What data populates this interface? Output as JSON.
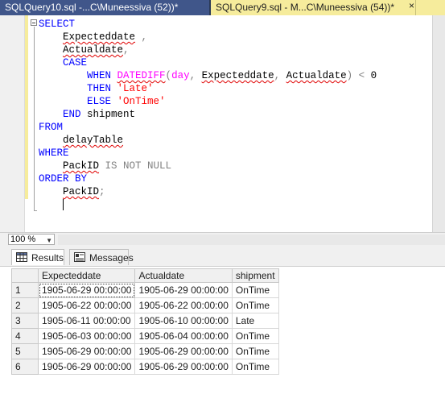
{
  "tabs": [
    {
      "label": "SQLQuery10.sql -...C\\Muneessiva (52))*",
      "active": false
    },
    {
      "label": "SQLQuery9.sql - M...C\\Muneessiva (54))*",
      "active": true,
      "close": "×"
    }
  ],
  "editor": {
    "lines": [
      {
        "tokens": [
          {
            "t": "SELECT",
            "c": "kw"
          }
        ]
      },
      {
        "tokens": [
          {
            "t": "    "
          },
          {
            "t": "Expecteddate",
            "c": "sq"
          },
          {
            "t": " ,",
            "c": "gr"
          }
        ]
      },
      {
        "tokens": [
          {
            "t": "    "
          },
          {
            "t": "Actualdate",
            "c": "sq"
          },
          {
            "t": ",",
            "c": "gr"
          }
        ]
      },
      {
        "tokens": [
          {
            "t": "    "
          },
          {
            "t": "CASE",
            "c": "kw"
          }
        ]
      },
      {
        "tokens": [
          {
            "t": "        "
          },
          {
            "t": "WHEN ",
            "c": "kw"
          },
          {
            "t": "DATEDIFF",
            "c": "fn sq"
          },
          {
            "t": "(",
            "c": "gr"
          },
          {
            "t": "day",
            "c": "fn"
          },
          {
            "t": ", ",
            "c": "gr"
          },
          {
            "t": "Expecteddate",
            "c": "sq"
          },
          {
            "t": ", ",
            "c": "gr"
          },
          {
            "t": "Actualdate",
            "c": "sq"
          },
          {
            "t": ")",
            "c": "gr"
          },
          {
            "t": " < ",
            "c": "gr"
          },
          {
            "t": "0"
          }
        ]
      },
      {
        "tokens": [
          {
            "t": "        "
          },
          {
            "t": "THEN ",
            "c": "kw"
          },
          {
            "t": "'Late'",
            "c": "str"
          }
        ]
      },
      {
        "tokens": [
          {
            "t": "        "
          },
          {
            "t": "ELSE ",
            "c": "kw"
          },
          {
            "t": "'OnTime'",
            "c": "str"
          }
        ]
      },
      {
        "tokens": [
          {
            "t": "    "
          },
          {
            "t": "END ",
            "c": "kw"
          },
          {
            "t": "shipment"
          }
        ]
      },
      {
        "tokens": [
          {
            "t": "FROM",
            "c": "kw"
          }
        ]
      },
      {
        "tokens": [
          {
            "t": "    "
          },
          {
            "t": "delayTable",
            "c": "sq"
          }
        ]
      },
      {
        "tokens": [
          {
            "t": "WHERE",
            "c": "kw"
          }
        ]
      },
      {
        "tokens": [
          {
            "t": "    "
          },
          {
            "t": "PackID",
            "c": "sq"
          },
          {
            "t": " IS NOT NULL",
            "c": "gr"
          }
        ]
      },
      {
        "tokens": [
          {
            "t": "ORDER BY",
            "c": "kw"
          }
        ]
      },
      {
        "tokens": [
          {
            "t": "    "
          },
          {
            "t": "PackID",
            "c": "sq"
          },
          {
            "t": ";",
            "c": "gr"
          }
        ]
      },
      {
        "tokens": [
          {
            "t": "    "
          }
        ],
        "caret": true
      }
    ]
  },
  "zoom": {
    "value": "100 %"
  },
  "result_tabs": [
    {
      "label": "Results",
      "icon": "grid-icon",
      "active": true
    },
    {
      "label": "Messages",
      "icon": "messages-icon",
      "active": false
    }
  ],
  "grid": {
    "columns": [
      "Expecteddate",
      "Actualdate",
      "shipment"
    ],
    "rows": [
      {
        "n": "1",
        "cells": [
          "1905-06-29 00:00:00",
          "1905-06-29 00:00:00",
          "OnTime"
        ]
      },
      {
        "n": "2",
        "cells": [
          "1905-06-22 00:00:00",
          "1905-06-22 00:00:00",
          "OnTime"
        ]
      },
      {
        "n": "3",
        "cells": [
          "1905-06-11 00:00:00",
          "1905-06-10 00:00:00",
          "Late"
        ]
      },
      {
        "n": "4",
        "cells": [
          "1905-06-03 00:00:00",
          "1905-06-04 00:00:00",
          "OnTime"
        ]
      },
      {
        "n": "5",
        "cells": [
          "1905-06-29 00:00:00",
          "1905-06-29 00:00:00",
          "OnTime"
        ]
      },
      {
        "n": "6",
        "cells": [
          "1905-06-29 00:00:00",
          "1905-06-29 00:00:00",
          "OnTime"
        ]
      }
    ]
  },
  "colors": {
    "tab_active": "#f6ec9c",
    "tab_inactive": "#40568a",
    "tabbar": "#2b3a57",
    "keyword": "#0000ff",
    "function": "#ff00ff",
    "string": "#ff0000",
    "operator": "#808080"
  }
}
